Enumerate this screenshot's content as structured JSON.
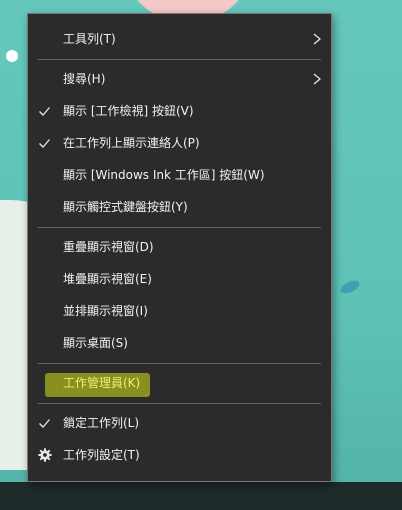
{
  "menu": {
    "items": [
      {
        "label": "工具列(T)",
        "checked": false,
        "submenu": true
      },
      {
        "label": "搜尋(H)",
        "checked": false,
        "submenu": true
      },
      {
        "label": "顯示 [工作檢視] 按鈕(V)",
        "checked": true,
        "submenu": false
      },
      {
        "label": "在工作列上顯示連絡人(P)",
        "checked": true,
        "submenu": false
      },
      {
        "label": "顯示 [Windows Ink 工作區] 按鈕(W)",
        "checked": false,
        "submenu": false
      },
      {
        "label": "顯示觸控式鍵盤按鈕(Y)",
        "checked": false,
        "submenu": false
      },
      {
        "label": "重疊顯示視窗(D)",
        "checked": false,
        "submenu": false
      },
      {
        "label": "堆疊顯示視窗(E)",
        "checked": false,
        "submenu": false
      },
      {
        "label": "並排顯示視窗(I)",
        "checked": false,
        "submenu": false
      },
      {
        "label": "顯示桌面(S)",
        "checked": false,
        "submenu": false
      },
      {
        "label": "工作管理員(K)",
        "checked": false,
        "submenu": false,
        "highlighted": true,
        "highlight_color": "#d9e21a"
      },
      {
        "label": "鎖定工作列(L)",
        "checked": true,
        "submenu": false
      },
      {
        "label": "工作列設定(T)",
        "checked": false,
        "submenu": false,
        "icon": "gear-icon"
      }
    ]
  },
  "colors": {
    "menu_bg": "#2b2b2b",
    "menu_text": "#f2f2f2",
    "separator": "#646464",
    "wallpaper": "#5fc4b9"
  }
}
